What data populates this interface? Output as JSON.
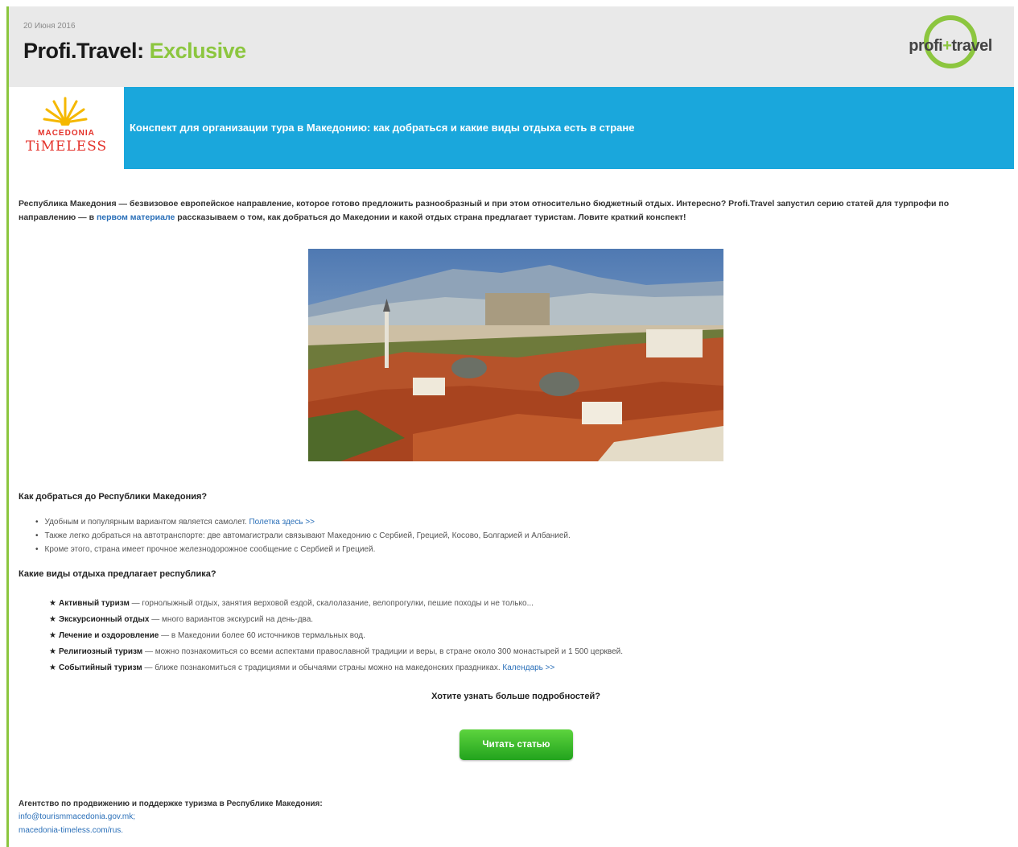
{
  "header": {
    "date": "20 Июня 2016",
    "title_main": "Profi.Travel: ",
    "title_accent": "Exclusive",
    "logo": {
      "left": "profi",
      "plus": "+",
      "right": "travel"
    }
  },
  "banner": {
    "logo_line1": "MACEDONIA",
    "logo_line2": "TiMELESS",
    "text": "Конспект для организации тура в Македонию: как добраться и какие виды отдыха есть в стране"
  },
  "intro": {
    "part1": "Республика Македония — безвизовое европейское направление, которое готово предложить разнообразный и при этом относительно бюджетный отдых. Интересно? Profi.Travel запустил серию статей для турпрофи по направлению — в ",
    "link": "первом материале",
    "part2": " рассказываем о том, как добраться до Македонии и какой отдых страна предлагает туристам. Ловите краткий конспект!"
  },
  "how_to_get": {
    "heading": "Как добраться до Республики Македония?",
    "items": [
      {
        "text": "Удобным и популярным вариантом является самолет. ",
        "link": "Полетка здесь >>"
      },
      {
        "text": "Также легко добраться на автотранспорте: две автомагистрали связывают Македонию с Сербией, Грецией, Косово, Болгарией и Албанией.",
        "link": ""
      },
      {
        "text": "Кроме этого, страна имеет прочное железнодорожное сообщение с Сербией и Грецией.",
        "link": ""
      }
    ]
  },
  "types": {
    "heading": "Какие виды отдыха предлагает республика?",
    "star": "★",
    "items": [
      {
        "title": "Активный туризм",
        "text": " — горнолыжный отдых, занятия верховой ездой, скалолазание, велопрогулки, пешие походы и не только...",
        "link": ""
      },
      {
        "title": "Экскурсионный отдых",
        "text": " — много вариантов экскурсий на день-два.",
        "link": ""
      },
      {
        "title": "Лечение и оздоровление",
        "text": " — в Македонии более 60 источников термальных вод.",
        "link": ""
      },
      {
        "title": "Религиозный туризм",
        "text": " — можно познакомиться со всеми аспектами православной традиции и веры, в стране около 300 монастырей и 1 500 церквей.",
        "link": ""
      },
      {
        "title": "Событийный туризм",
        "text": " — ближе познакомиться с традициями и обычаями страны можно на македонских праздниках. ",
        "link": "Календарь >>"
      }
    ]
  },
  "cta": {
    "question": "Хотите узнать больше подробностей?",
    "button": "Читать статью"
  },
  "footer": {
    "title": "Агентство по продвижению и поддержке туризма в Республике Македония:",
    "email": "info@tourismmacedonia.gov.mk;",
    "site": "macedonia-timeless.com/rus."
  },
  "colors": {
    "accent_green": "#8cc63f",
    "banner_blue": "#1aa7dc",
    "link_blue": "#2a6fb8",
    "button_green": "#22a31d"
  }
}
